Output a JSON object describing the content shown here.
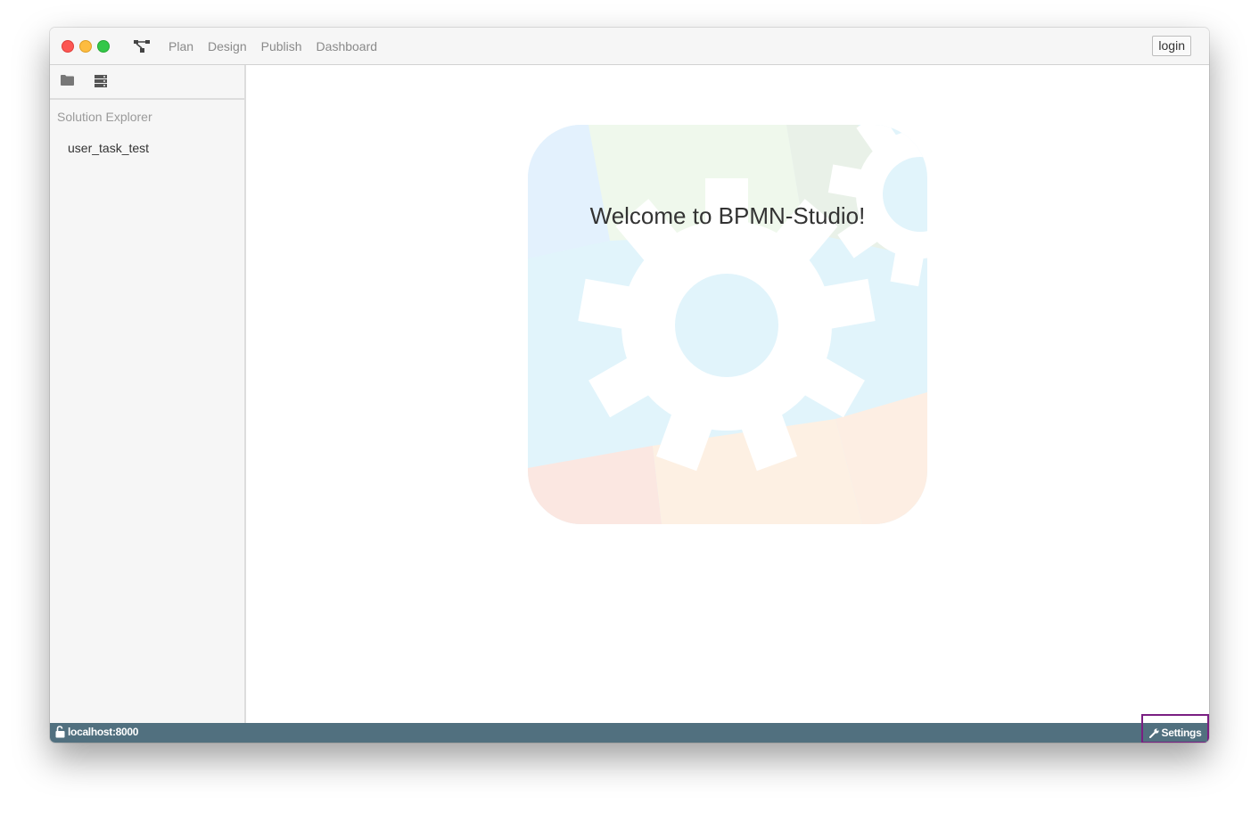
{
  "nav": {
    "items": [
      "Plan",
      "Design",
      "Publish",
      "Dashboard"
    ]
  },
  "header": {
    "login_label": "login"
  },
  "sidebar": {
    "title": "Solution Explorer",
    "items": [
      "user_task_test"
    ]
  },
  "main": {
    "welcome": "Welcome to BPMN-Studio!"
  },
  "statusbar": {
    "host": "localhost:8000",
    "settings_label": "Settings"
  },
  "colors": {
    "statusbar": "#51707f",
    "highlight": "#7a1f82"
  }
}
